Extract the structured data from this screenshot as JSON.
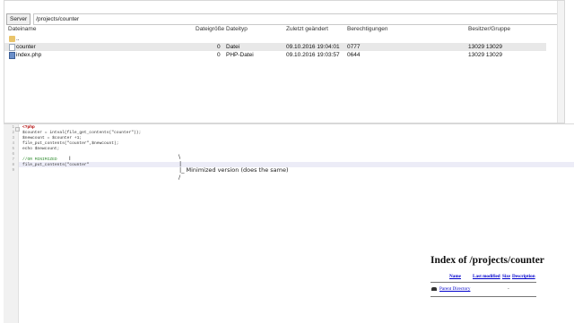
{
  "file_manager": {
    "server_button": "Server",
    "path": "/projects/counter",
    "columns": {
      "name": "Dateiname",
      "size": "Dateigröße",
      "type": "Dateityp",
      "modified": "Zuletzt geändert",
      "permissions": "Berechtigungen",
      "owner": "Besitzer/Gruppe"
    },
    "rows": [
      {
        "name": "..",
        "size": "",
        "type": "",
        "modified": "",
        "permissions": "",
        "owner": "",
        "icon": "folder-icon"
      },
      {
        "name": "counter",
        "size": "0",
        "type": "Datei",
        "modified": "09.10.2016 19:04:01",
        "permissions": "0777",
        "owner": "13029 13029",
        "icon": "file-icon"
      },
      {
        "name": "index.php",
        "size": "0",
        "type": "PHP-Datei",
        "modified": "09.10.2016 19:03:57",
        "permissions": "0644",
        "owner": "13029 13029",
        "icon": "php-file-icon"
      }
    ]
  },
  "editor": {
    "line_numbers": [
      "1",
      "2",
      "3",
      "4",
      "5",
      "6",
      "7",
      "8",
      "9"
    ],
    "lines": [
      "<?php",
      "$counter = intval(file_get_contents(\"counter\"));",
      "$newcount = $counter +1;",
      "file_put_contents(\"counter\",$newcount);",
      "echo $newcount;",
      "",
      "//OR MINIMIZED",
      "file_put_contents(\"counter\"",
      ""
    ]
  },
  "annotation": {
    "line1": "\\",
    "line2": "|",
    "line3": "|_ Minimized version (does the same)",
    "line4": "/"
  },
  "index_page": {
    "title": "Index of /projects/counter",
    "columns": [
      "Name",
      "Last modified",
      "Size",
      "Description"
    ],
    "parent_link": "Parent Directory",
    "parent_size": "-"
  }
}
